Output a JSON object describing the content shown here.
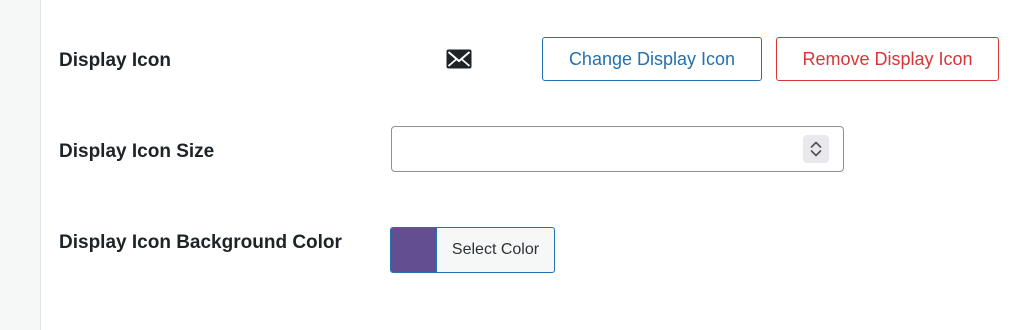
{
  "fields": {
    "display_icon": {
      "label": "Display Icon",
      "icon": "envelope-icon",
      "change_button": "Change Display Icon",
      "remove_button": "Remove Display Icon"
    },
    "display_icon_size": {
      "label": "Display Icon Size",
      "value": ""
    },
    "display_icon_background_color": {
      "label": "Display Icon Background Color",
      "button_label": "Select Color",
      "color": "#614f92"
    }
  },
  "colors": {
    "primary": "#2271b1",
    "danger": "#d63638",
    "text": "#1d2327"
  }
}
